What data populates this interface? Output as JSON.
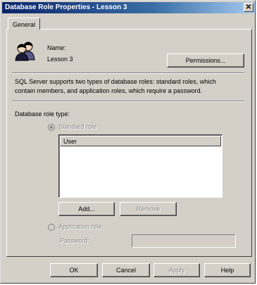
{
  "window": {
    "title": "Database Role Properties - Lesson 3",
    "close_glyph": "✕"
  },
  "tabs": [
    {
      "label": "General"
    }
  ],
  "general": {
    "name_label": "Name:",
    "name_value": "Lesson 3",
    "permissions_label": "Permissions...",
    "description": [
      "SQL Server supports two types of database roles: standard roles, which",
      "contain members, and application roles, which require a password."
    ],
    "role_type_label": "Database role type:",
    "standard_role_label": "Standard role",
    "standard_role_selected": true,
    "members_header": "User",
    "add_label": "Add...",
    "remove_label": "Remove",
    "application_role_label": "Application role",
    "password_label": "Password:",
    "password_value": ""
  },
  "buttons": {
    "ok": "OK",
    "cancel": "Cancel",
    "apply": "Apply",
    "help": "Help"
  },
  "icons": {
    "role": "users-group-icon",
    "close": "close-icon"
  },
  "colors": {
    "titlebar_start": "#0a246a",
    "titlebar_end": "#a6caf0",
    "face": "#d4d0c8"
  }
}
